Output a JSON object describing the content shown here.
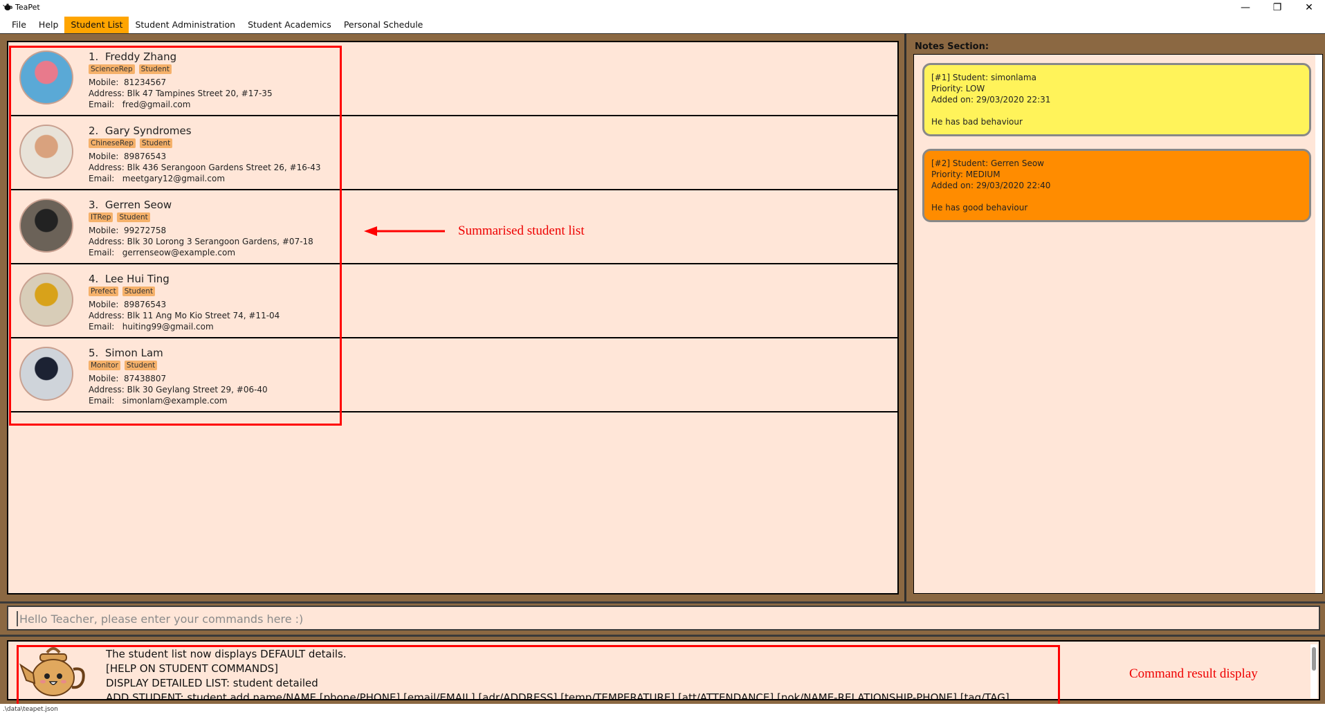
{
  "window": {
    "title": "TeaPet",
    "minimize_glyph": "—",
    "restore_glyph": "❐",
    "close_glyph": "✕"
  },
  "menu": [
    {
      "label": "File",
      "active": false
    },
    {
      "label": "Help",
      "active": false
    },
    {
      "label": "Student List",
      "active": true
    },
    {
      "label": "Student Administration",
      "active": false
    },
    {
      "label": "Student Academics",
      "active": false
    },
    {
      "label": "Personal Schedule",
      "active": false
    }
  ],
  "students": [
    {
      "index": "1.",
      "name": "Freddy Zhang",
      "tags": [
        "ScienceRep",
        "Student"
      ],
      "mobile_label": "Mobile:",
      "mobile": "81234567",
      "address_label": "Address:",
      "address": "Blk 47 Tampines Street 20, #17-35",
      "email_label": "Email:",
      "email": "fred@gmail.com",
      "avatar_colors": [
        "#5aa9d6",
        "#e87a8c"
      ]
    },
    {
      "index": "2.",
      "name": "Gary Syndromes",
      "tags": [
        "ChineseRep",
        "Student"
      ],
      "mobile_label": "Mobile:",
      "mobile": "89876543",
      "address_label": "Address:",
      "address": "Blk 436 Serangoon Gardens Street 26, #16-43",
      "email_label": "Email:",
      "email": "meetgary12@gmail.com",
      "avatar_colors": [
        "#e8e2d8",
        "#d9a27e"
      ]
    },
    {
      "index": "3.",
      "name": "Gerren Seow",
      "tags": [
        "ITRep",
        "Student"
      ],
      "mobile_label": "Mobile:",
      "mobile": "99272758",
      "address_label": "Address:",
      "address": "Blk 30 Lorong 3 Serangoon Gardens, #07-18",
      "email_label": "Email:",
      "email": "gerrenseow@example.com",
      "avatar_colors": [
        "#6b6258",
        "#222222"
      ]
    },
    {
      "index": "4.",
      "name": "Lee Hui Ting",
      "tags": [
        "Prefect",
        "Student"
      ],
      "mobile_label": "Mobile:",
      "mobile": "89876543",
      "address_label": "Address:",
      "address": "Blk 11 Ang Mo Kio Street 74, #11-04",
      "email_label": "Email:",
      "email": "huiting99@gmail.com",
      "avatar_colors": [
        "#d8cdb8",
        "#d8a21a"
      ]
    },
    {
      "index": "5.",
      "name": "Simon Lam",
      "tags": [
        "Monitor",
        "Student"
      ],
      "mobile_label": "Mobile:",
      "mobile": "87438807",
      "address_label": "Address:",
      "address": "Blk 30 Geylang Street 29, #06-40",
      "email_label": "Email:",
      "email": "simonlam@example.com",
      "avatar_colors": [
        "#cfd4da",
        "#1c2233"
      ]
    }
  ],
  "annotations": {
    "list_label": "Summarised student list",
    "result_label": "Command result display",
    "color": "#ff0000"
  },
  "notes": {
    "header": "Notes Section:",
    "items": [
      {
        "line1": "[#1] Student: simonlama",
        "line2": "Priority: LOW",
        "line3": "Added on: 29/03/2020 22:31",
        "body": "He has bad behaviour",
        "color": "#fff35a"
      },
      {
        "line1": "[#2] Student: Gerren Seow",
        "line2": "Priority: MEDIUM",
        "line3": "Added on: 29/03/2020 22:40",
        "body": "He has good behaviour",
        "color": "#ff8c00"
      }
    ]
  },
  "command": {
    "placeholder": "Hello Teacher, please enter your commands here :)",
    "value": ""
  },
  "result": {
    "lines": [
      "The student list now displays DEFAULT details.",
      "[HELP ON STUDENT COMMANDS]",
      "DISPLAY DETAILED LIST: student detailed",
      "ADD STUDENT: student add name/NAME [phone/PHONE] [email/EMAIL] [adr/ADDRESS] [temp/TEMPERATURE] [att/ATTENDANCE] [nok/NAME-RELATIONSHIP-PHONE] [tag/TAG]"
    ]
  },
  "status": {
    "path": ".\\data\\teapet.json"
  },
  "colors": {
    "frame": "#8b6842",
    "panel": "#ffe6d8",
    "menu_active": "#ffa500",
    "tag": "#f5b16a"
  }
}
